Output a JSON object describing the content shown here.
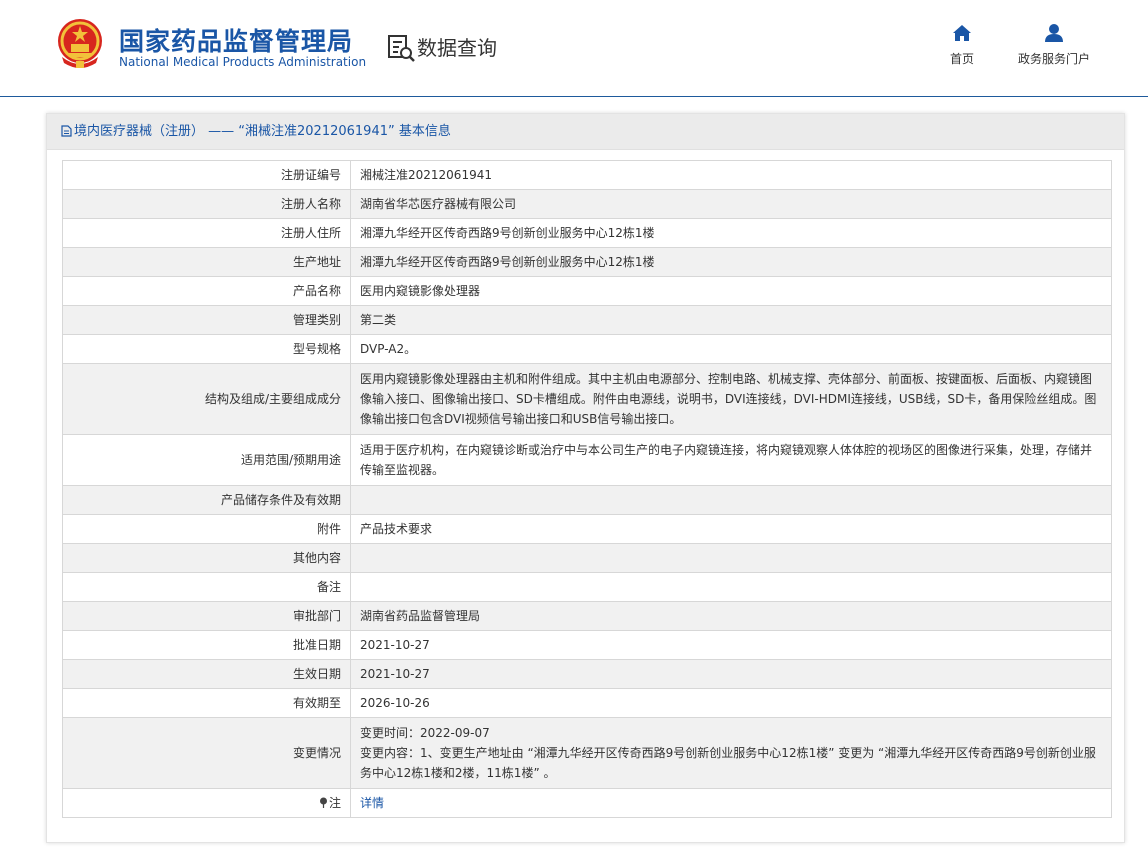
{
  "header": {
    "logo_cn": "国家药品监督管理局",
    "logo_en": "National Medical Products Administration",
    "section_title": "数据查询",
    "nav": [
      {
        "label": "首页",
        "icon": "home-icon"
      },
      {
        "label": "政务服务门户",
        "icon": "user-icon"
      }
    ]
  },
  "panel": {
    "title": "境内医疗器械（注册） ——  “湘械注准20212061941” 基本信息"
  },
  "rows": [
    {
      "label": "注册证编号",
      "value": "湘械注准20212061941"
    },
    {
      "label": "注册人名称",
      "value": "湖南省华芯医疗器械有限公司"
    },
    {
      "label": "注册人住所",
      "value": "湘潭九华经开区传奇西路9号创新创业服务中心12栋1楼"
    },
    {
      "label": "生产地址",
      "value": "湘潭九华经开区传奇西路9号创新创业服务中心12栋1楼"
    },
    {
      "label": "产品名称",
      "value": "医用内窥镜影像处理器"
    },
    {
      "label": "管理类别",
      "value": "第二类"
    },
    {
      "label": "型号规格",
      "value": "DVP-A2。"
    },
    {
      "label": "结构及组成/主要组成成分",
      "value": "医用内窥镜影像处理器由主机和附件组成。其中主机由电源部分、控制电路、机械支撑、壳体部分、前面板、按键面板、后面板、内窥镜图像输入接口、图像输出接口、SD卡槽组成。附件由电源线，说明书，DVI连接线，DVI-HDMI连接线，USB线，SD卡，备用保险丝组成。图像输出接口包含DVI视频信号输出接口和USB信号输出接口。"
    },
    {
      "label": "适用范围/预期用途",
      "value": "适用于医疗机构，在内窥镜诊断或治疗中与本公司生产的电子内窥镜连接，将内窥镜观察人体体腔的视场区的图像进行采集，处理，存储并传输至监视器。"
    },
    {
      "label": "产品储存条件及有效期",
      "value": ""
    },
    {
      "label": "附件",
      "value": "产品技术要求"
    },
    {
      "label": "其他内容",
      "value": ""
    },
    {
      "label": "备注",
      "value": ""
    },
    {
      "label": "审批部门",
      "value": "湖南省药品监督管理局"
    },
    {
      "label": "批准日期",
      "value": "2021-10-27"
    },
    {
      "label": "生效日期",
      "value": "2021-10-27"
    },
    {
      "label": "有效期至",
      "value": "2026-10-26"
    }
  ],
  "change": {
    "label": "变更情况",
    "time": "变更时间：2022-09-07",
    "content": "变更内容：1、变更生产地址由 “湘潭九华经开区传奇西路9号创新创业服务中心12栋1楼” 变更为 “湘潭九华经开区传奇西路9号创新创业服务中心12栋1楼和2楼，11栋1楼” 。"
  },
  "note": {
    "label": "注",
    "icon": "pin-icon",
    "link": "详情"
  },
  "colors": {
    "brand_blue": "#1a56a6",
    "row_alt": "#f1f1f1",
    "border": "#d7d7d7"
  }
}
